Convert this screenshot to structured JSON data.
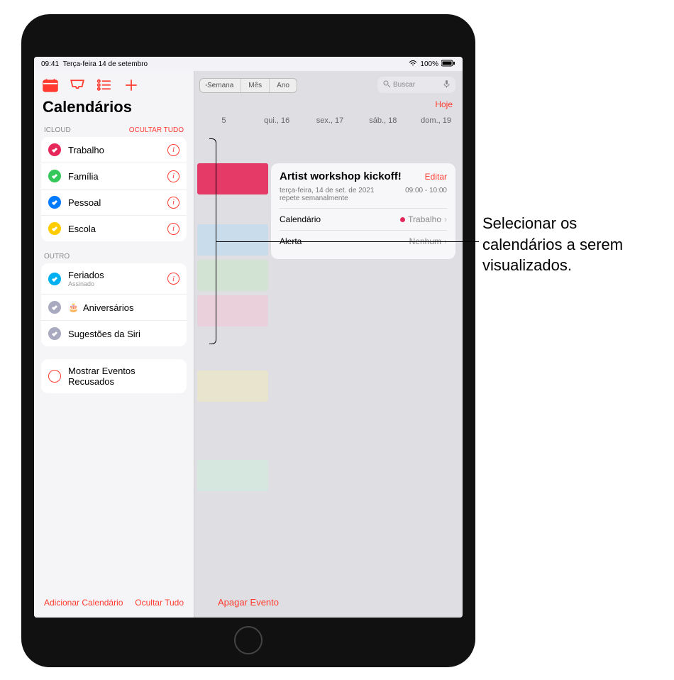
{
  "status": {
    "time": "09:41",
    "date": "Terça-feira 14 de setembro",
    "battery": "100%"
  },
  "toolbar_seg": {
    "week": "Semana",
    "month": "Mês",
    "year": "Ano"
  },
  "search": {
    "placeholder": "Buscar"
  },
  "today": "Hoje",
  "day_headers": [
    "5",
    "qui., 16",
    "sex., 17",
    "sáb., 18",
    "dom., 19"
  ],
  "sidebar": {
    "title": "Calendários",
    "icloud_hdr": "ICLOUD",
    "hide_all": "OCULTAR TUDO",
    "icloud": [
      {
        "label": "Trabalho",
        "color": "#e6275a"
      },
      {
        "label": "Família",
        "color": "#34c759"
      },
      {
        "label": "Pessoal",
        "color": "#007aff"
      },
      {
        "label": "Escola",
        "color": "#ffcc00"
      }
    ],
    "other_hdr": "OUTRO",
    "other": [
      {
        "label": "Feriados",
        "sub": "Assinado",
        "color": "#00b0f0",
        "info": true
      },
      {
        "label": "Aniversários",
        "color": "#a0a0b8",
        "cake": true
      },
      {
        "label": "Sugestões da Siri",
        "color": "#a0a0b8"
      }
    ],
    "refused": "Mostrar Eventos Recusados",
    "add_cal": "Adicionar Calendário",
    "hide_all_btn": "Ocultar Tudo"
  },
  "event": {
    "title": "Artist workshop kickoff!",
    "edit": "Editar",
    "subtitle": "terça-feira, 14 de set. de 2021",
    "time": "09:00 - 10:00",
    "repeat": "repete semanalmente",
    "cal_label": "Calendário",
    "cal_value": "Trabalho",
    "alert_label": "Alerta",
    "alert_value": "Nenhum",
    "delete": "Apagar Evento"
  },
  "annotation": "Selecionar os calendários a serem visualizados."
}
